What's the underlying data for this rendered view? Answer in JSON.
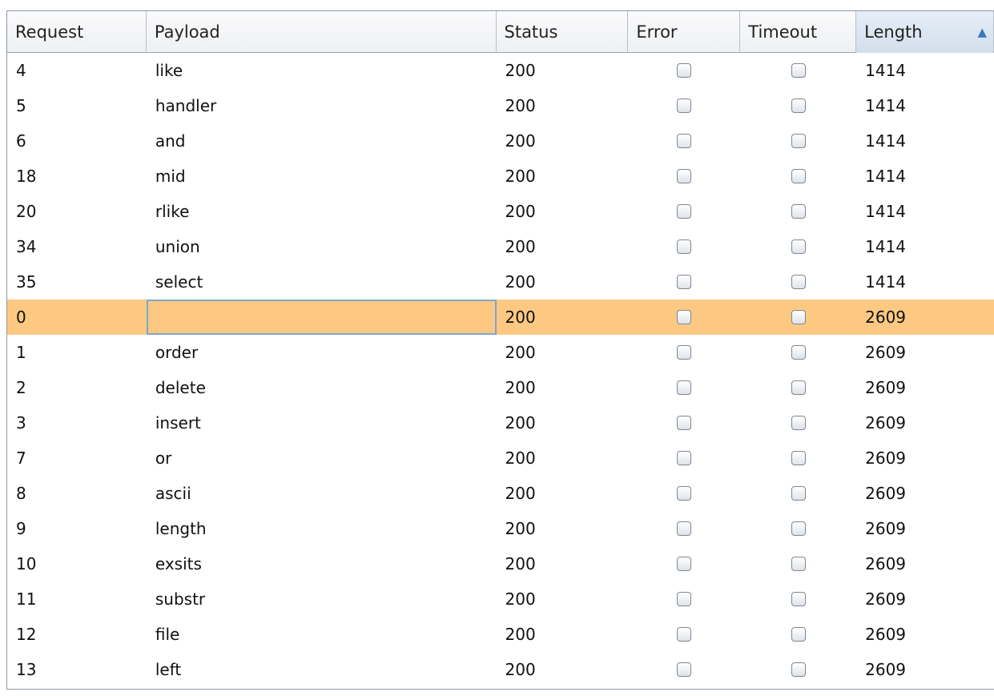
{
  "table": {
    "columns": [
      "Request",
      "Payload",
      "Status",
      "Error",
      "Timeout",
      "Length"
    ],
    "sorted_column": "Length",
    "sort_direction": "ascending",
    "selected_row": 7,
    "rows": [
      {
        "request": "4",
        "payload": "like",
        "status": "200",
        "error": false,
        "timeout": false,
        "length": "1414"
      },
      {
        "request": "5",
        "payload": "handler",
        "status": "200",
        "error": false,
        "timeout": false,
        "length": "1414"
      },
      {
        "request": "6",
        "payload": "and",
        "status": "200",
        "error": false,
        "timeout": false,
        "length": "1414"
      },
      {
        "request": "18",
        "payload": "mid",
        "status": "200",
        "error": false,
        "timeout": false,
        "length": "1414"
      },
      {
        "request": "20",
        "payload": "rlike",
        "status": "200",
        "error": false,
        "timeout": false,
        "length": "1414"
      },
      {
        "request": "34",
        "payload": "union",
        "status": "200",
        "error": false,
        "timeout": false,
        "length": "1414"
      },
      {
        "request": "35",
        "payload": "select",
        "status": "200",
        "error": false,
        "timeout": false,
        "length": "1414"
      },
      {
        "request": "0",
        "payload": "",
        "status": "200",
        "error": false,
        "timeout": false,
        "length": "2609"
      },
      {
        "request": "1",
        "payload": "order",
        "status": "200",
        "error": false,
        "timeout": false,
        "length": "2609"
      },
      {
        "request": "2",
        "payload": "delete",
        "status": "200",
        "error": false,
        "timeout": false,
        "length": "2609"
      },
      {
        "request": "3",
        "payload": "insert",
        "status": "200",
        "error": false,
        "timeout": false,
        "length": "2609"
      },
      {
        "request": "7",
        "payload": "or",
        "status": "200",
        "error": false,
        "timeout": false,
        "length": "2609"
      },
      {
        "request": "8",
        "payload": "ascii",
        "status": "200",
        "error": false,
        "timeout": false,
        "length": "2609"
      },
      {
        "request": "9",
        "payload": "length",
        "status": "200",
        "error": false,
        "timeout": false,
        "length": "2609"
      },
      {
        "request": "10",
        "payload": "exsits",
        "status": "200",
        "error": false,
        "timeout": false,
        "length": "2609"
      },
      {
        "request": "11",
        "payload": "substr",
        "status": "200",
        "error": false,
        "timeout": false,
        "length": "2609"
      },
      {
        "request": "12",
        "payload": "file",
        "status": "200",
        "error": false,
        "timeout": false,
        "length": "2609"
      },
      {
        "request": "13",
        "payload": "left",
        "status": "200",
        "error": false,
        "timeout": false,
        "length": "2609"
      }
    ]
  },
  "colors": {
    "selected_row": "#fdc982",
    "focus_border": "#7fa5cc",
    "sort_arrow": "#3b78b8"
  },
  "icons": {
    "sort": "sort-ascending-icon",
    "checkbox": "checkbox-unchecked-icon"
  }
}
